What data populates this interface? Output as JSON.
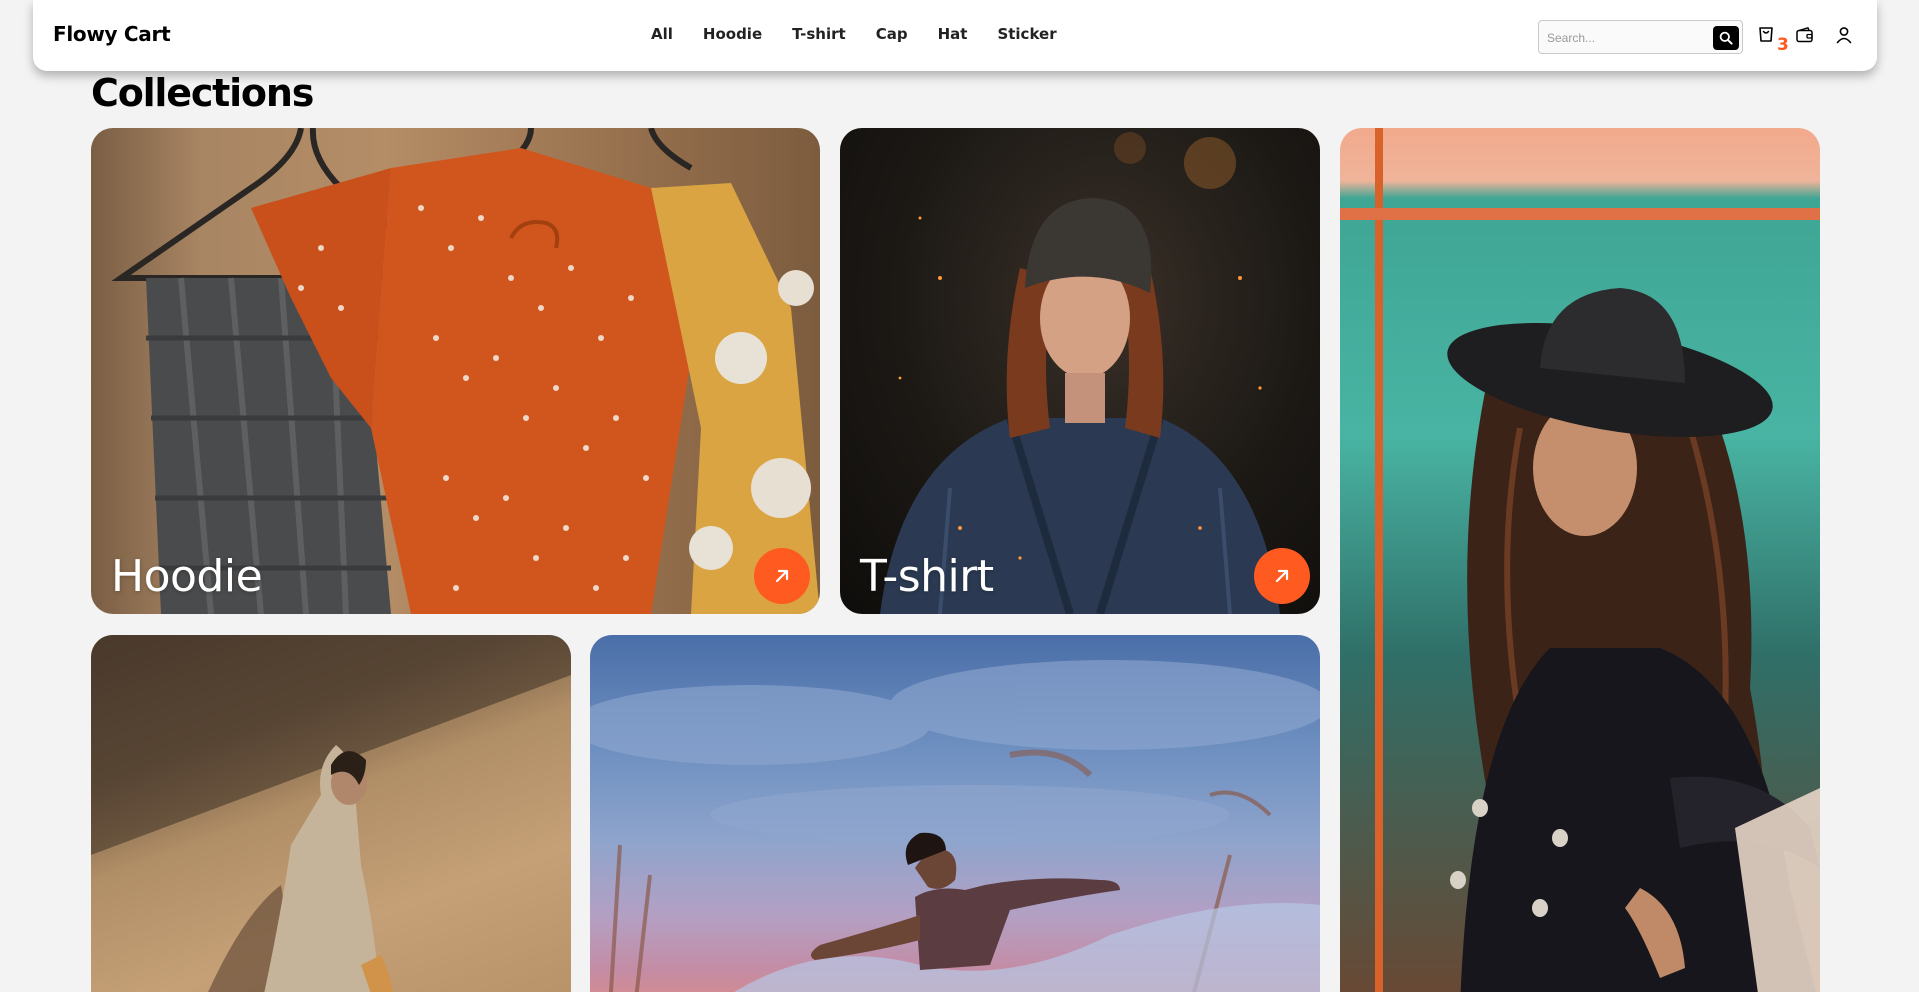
{
  "brand": {
    "name": "Flowy Cart"
  },
  "nav": {
    "links": [
      "All",
      "Hoodie",
      "T-shirt",
      "Cap",
      "Hat",
      "Sticker"
    ]
  },
  "search": {
    "placeholder": "Search..."
  },
  "header_icons": {
    "cart": "cart-icon",
    "wallet": "wallet-icon",
    "user": "user-icon",
    "search": "search-icon"
  },
  "cart": {
    "count": "3"
  },
  "collections": {
    "title": "Collections",
    "cards": [
      {
        "label": "Hoodie",
        "photo": "shirts on hangers"
      },
      {
        "label": "T-shirt",
        "photo": "woman in beanie and denim jacket"
      },
      {
        "label": "",
        "photo": "woman in black hat"
      },
      {
        "label": "",
        "photo": "woman in trench coat walking"
      },
      {
        "label": "",
        "photo": "girl dancing under blue sky"
      }
    ]
  },
  "colors": {
    "accent": "#ff5a1f",
    "background": "#f3f3f3",
    "header": "#ffffff"
  }
}
